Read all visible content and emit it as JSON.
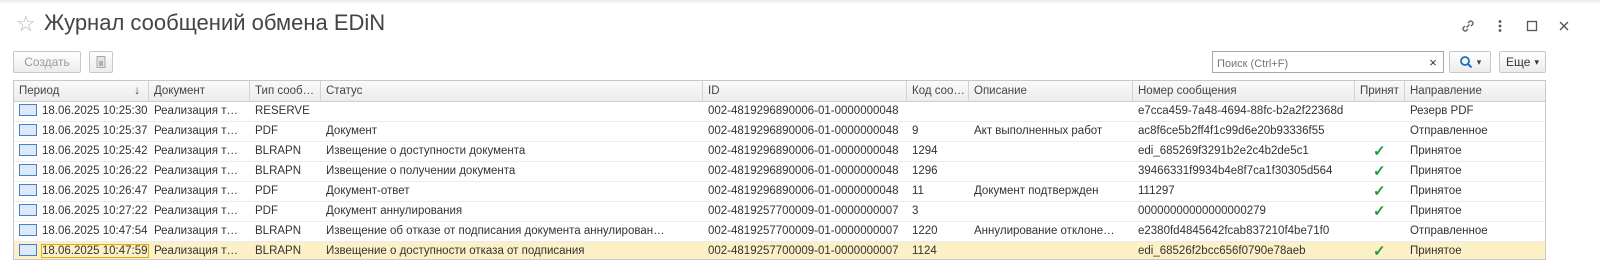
{
  "window": {
    "title": "Журнал сообщений обмена EDiN",
    "icons": [
      "link-icon",
      "more-vertical-icon",
      "maximize-icon",
      "close-icon"
    ]
  },
  "toolbar": {
    "create_label": "Создать",
    "search_placeholder": "Поиск (Ctrl+F)",
    "search_clear": "×",
    "search_icon": "search-icon",
    "more_label": "Еще"
  },
  "table": {
    "columns": [
      "Период",
      "Документ",
      "Тип сооб…",
      "Статус",
      "ID",
      "Код соо…",
      "Описание",
      "Номер сообщения",
      "Принят",
      "Направление"
    ],
    "sort_indicator": "↓",
    "rows": [
      {
        "period": "18.06.2025 10:25:30",
        "doc": "Реализация т…",
        "type": "RESERVE",
        "status": "",
        "id": "002-4819296890006-01-0000000048",
        "code": "",
        "desc": "",
        "num": "e7cca459-7a48-4694-88fc-b2a2f22368d",
        "accepted": false,
        "dir": "Резерв PDF"
      },
      {
        "period": "18.06.2025 10:25:37",
        "doc": "Реализация т…",
        "type": "PDF",
        "status": "Документ",
        "id": "002-4819296890006-01-0000000048",
        "code": "9",
        "desc": "Акт выполненных работ",
        "num": "ac8f6ce5b2ff4f1c99d6e20b93336f55",
        "accepted": false,
        "dir": "Отправленное"
      },
      {
        "period": "18.06.2025 10:25:42",
        "doc": "Реализация т…",
        "type": "BLRAPN",
        "status": "Извещение о доступности документа",
        "id": "002-4819296890006-01-0000000048",
        "code": "1294",
        "desc": "",
        "num": "edi_685269f3291b2e2c4b2de5c1",
        "accepted": true,
        "dir": "Принятое"
      },
      {
        "period": "18.06.2025 10:26:22",
        "doc": "Реализация т…",
        "type": "BLRAPN",
        "status": "Извещение о получении документа",
        "id": "002-4819296890006-01-0000000048",
        "code": "1296",
        "desc": "",
        "num": "39466331f9934b4e8f7ca1f30305d564",
        "accepted": true,
        "dir": "Принятое"
      },
      {
        "period": "18.06.2025 10:26:47",
        "doc": "Реализация т…",
        "type": "PDF",
        "status": "Документ-ответ",
        "id": "002-4819296890006-01-0000000048",
        "code": "11",
        "desc": "Документ подтвержден",
        "num": "111297",
        "accepted": true,
        "dir": "Принятое"
      },
      {
        "period": "18.06.2025 10:27:22",
        "doc": "Реализация т…",
        "type": "PDF",
        "status": "Документ аннулирования",
        "id": "002-4819257700009-01-0000000007",
        "code": "3",
        "desc": "",
        "num": "00000000000000000279",
        "accepted": true,
        "dir": "Принятое"
      },
      {
        "period": "18.06.2025 10:47:54",
        "doc": "Реализация т…",
        "type": "BLRAPN",
        "status": "Извещение об отказе от подписания документа аннулирован…",
        "id": "002-4819257700009-01-0000000007",
        "code": "1220",
        "desc": "Аннулирование отклоне…",
        "num": "e2380fd4845642fcab837210f4be71f0",
        "accepted": false,
        "dir": "Отправленное"
      },
      {
        "period": "18.06.2025 10:47:59",
        "doc": "Реализация т…",
        "type": "BLRAPN",
        "status": "Извещение о доступности отказа от подписания",
        "id": "002-4819257700009-01-0000000007",
        "code": "1124",
        "desc": "",
        "num": "edi_68526f2bcc656f0790e78aeb",
        "accepted": true,
        "dir": "Принятое",
        "selected": true
      }
    ],
    "check_glyph": "✓"
  },
  "colors": {
    "selected_row": "#fcf0c6",
    "accent": "#1f6fc4",
    "check": "#1e9c3a"
  }
}
